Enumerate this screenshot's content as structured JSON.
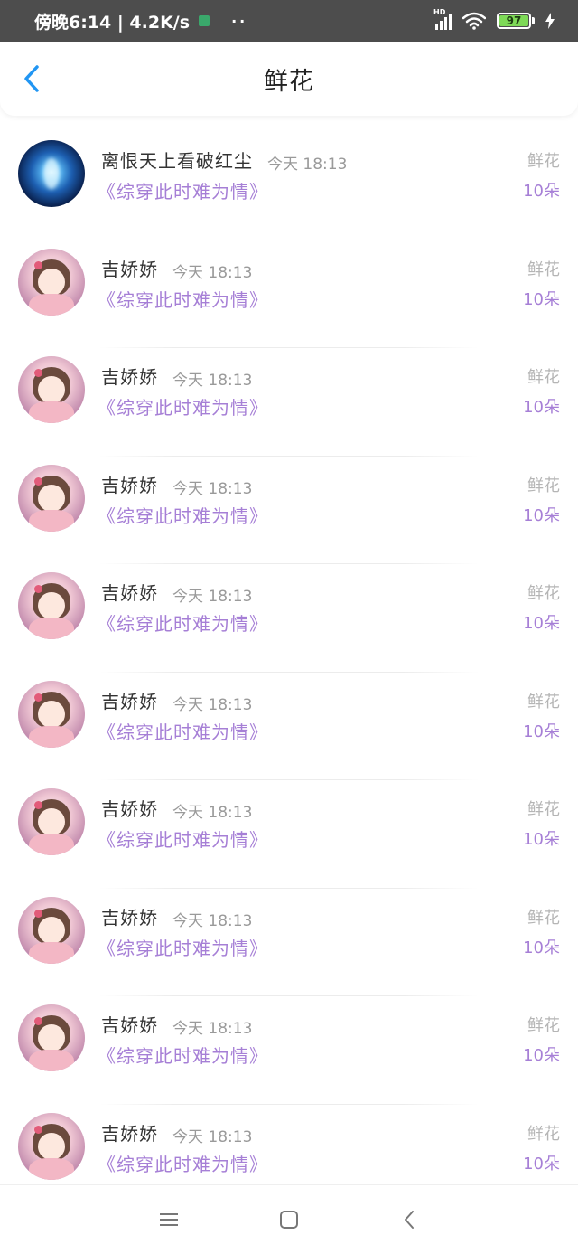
{
  "status_bar": {
    "time": "傍晚6:14 | 4.2K/s",
    "dots": "··",
    "signal_label": "HD",
    "battery": "97",
    "icons": [
      "shield-icon",
      "signal-icon",
      "wifi-icon",
      "battery-icon",
      "charging-icon"
    ]
  },
  "header": {
    "title": "鲜花",
    "back_icon": "chevron-left-icon"
  },
  "colors": {
    "accent": "#a67fd6",
    "back": "#2196f3",
    "status_bg": "#4d4d4d",
    "muted": "#b5b5b5"
  },
  "rows": [
    {
      "name": "离恨天上看破红尘",
      "time": "今天 18:13",
      "book": "《综穿此时难为情》",
      "gift": "鲜花",
      "count": "10朵",
      "avatar": "night"
    },
    {
      "name": "吉娇娇",
      "time": "今天 18:13",
      "book": "《综穿此时难为情》",
      "gift": "鲜花",
      "count": "10朵",
      "avatar": "girl"
    },
    {
      "name": "吉娇娇",
      "time": "今天 18:13",
      "book": "《综穿此时难为情》",
      "gift": "鲜花",
      "count": "10朵",
      "avatar": "girl"
    },
    {
      "name": "吉娇娇",
      "time": "今天 18:13",
      "book": "《综穿此时难为情》",
      "gift": "鲜花",
      "count": "10朵",
      "avatar": "girl"
    },
    {
      "name": "吉娇娇",
      "time": "今天 18:13",
      "book": "《综穿此时难为情》",
      "gift": "鲜花",
      "count": "10朵",
      "avatar": "girl"
    },
    {
      "name": "吉娇娇",
      "time": "今天 18:13",
      "book": "《综穿此时难为情》",
      "gift": "鲜花",
      "count": "10朵",
      "avatar": "girl"
    },
    {
      "name": "吉娇娇",
      "time": "今天 18:13",
      "book": "《综穿此时难为情》",
      "gift": "鲜花",
      "count": "10朵",
      "avatar": "girl"
    },
    {
      "name": "吉娇娇",
      "time": "今天 18:13",
      "book": "《综穿此时难为情》",
      "gift": "鲜花",
      "count": "10朵",
      "avatar": "girl"
    },
    {
      "name": "吉娇娇",
      "time": "今天 18:13",
      "book": "《综穿此时难为情》",
      "gift": "鲜花",
      "count": "10朵",
      "avatar": "girl"
    },
    {
      "name": "吉娇娇",
      "time": "今天 18:13",
      "book": "《综穿此时难为情》",
      "gift": "鲜花",
      "count": "10朵",
      "avatar": "girl"
    }
  ],
  "navbar": {
    "icons": [
      "menu-icon",
      "home-square-icon",
      "back-arrow-icon"
    ]
  }
}
